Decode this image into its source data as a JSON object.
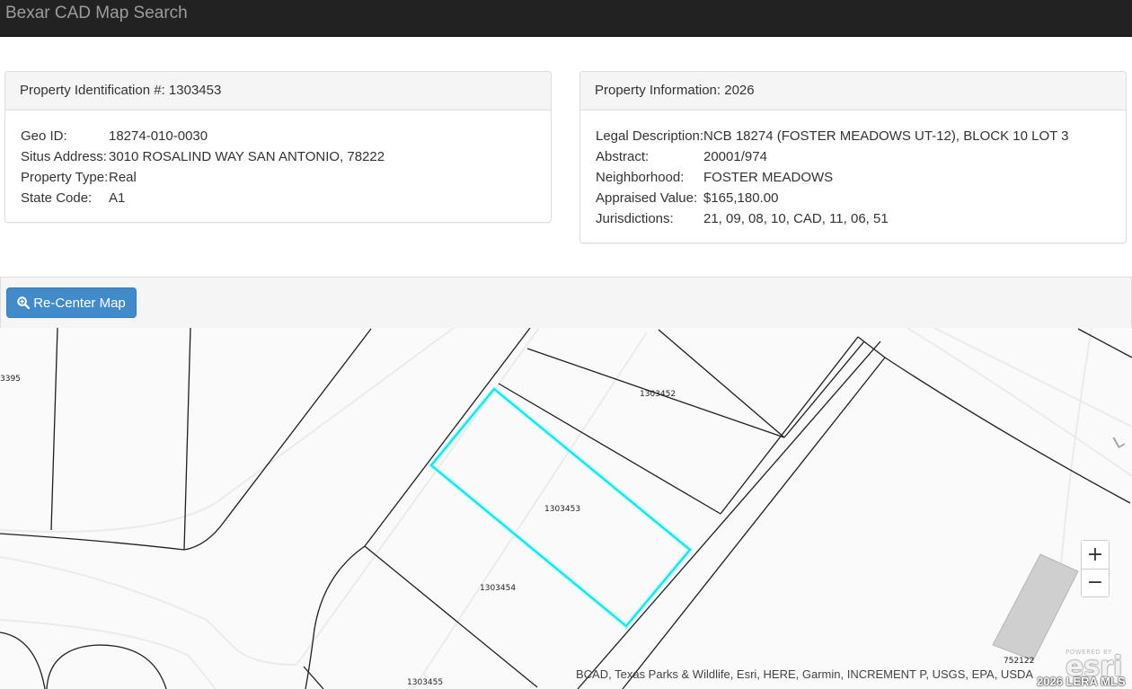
{
  "header": {
    "title": "Bexar CAD Map Search"
  },
  "property_id_panel": {
    "title": "Property Identification #: 1303453",
    "fields": [
      {
        "label": "Geo ID:",
        "value": "18274-010-0030"
      },
      {
        "label": "Situs Address:",
        "value": "3010 ROSALIND WAY SAN ANTONIO, 78222"
      },
      {
        "label": "Property Type:",
        "value": "Real"
      },
      {
        "label": "State Code:",
        "value": "A1"
      }
    ]
  },
  "property_info_panel": {
    "title": "Property Information: 2026",
    "fields": [
      {
        "label": "Legal Description:",
        "value": "NCB 18274 (FOSTER MEADOWS UT-12), BLOCK 10 LOT 3"
      },
      {
        "label": "Abstract:",
        "value": "20001/974"
      },
      {
        "label": "Neighborhood:",
        "value": "FOSTER MEADOWS"
      },
      {
        "label": "Appraised Value:",
        "value": "$165,180.00"
      },
      {
        "label": "Jurisdictions:",
        "value": "21, 09, 08, 10, CAD, 11, 06, 51"
      }
    ]
  },
  "map_toolbar": {
    "recenter_label": "Re-Center Map",
    "recenter_icon": "zoom-in-magnifier-icon"
  },
  "map": {
    "parcel_labels": [
      "3395",
      "1303452",
      "1303453",
      "1303454",
      "1303455",
      "752122"
    ],
    "street_label_fragment": "L",
    "selected_parcel": "1303453",
    "highlight_color": "#00e5ee",
    "zoom_in_label": "+",
    "zoom_out_label": "−",
    "attribution": "BCAD, Texas Parks & Wildlife, Esri, HERE, Garmin, INCREMENT P, USGS, EPA, USDA",
    "logo_powered": "POWERED BY",
    "logo_word": "esri"
  },
  "watermark": "2026 LERA MLS",
  "colors": {
    "topbar": "#222222",
    "button": "#428bca",
    "panel_heading": "#f5f5f5"
  }
}
